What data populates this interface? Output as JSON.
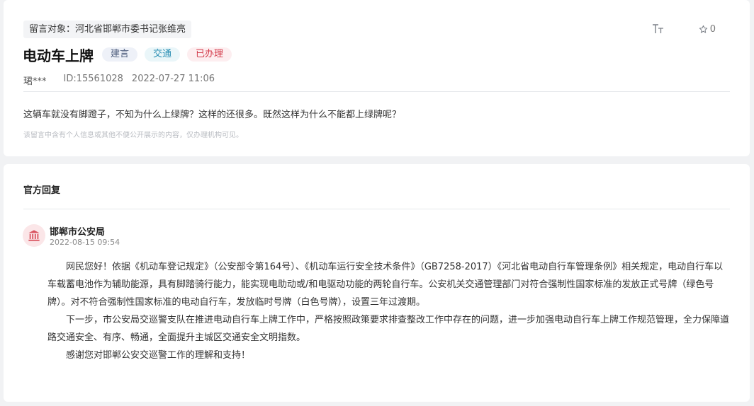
{
  "message": {
    "target": "留言对象：河北省邯郸市委书记张维亮",
    "title": "电动车上牌",
    "tags": [
      "建言",
      "交通",
      "已办理"
    ],
    "font_size_icon": "font-size-icon",
    "favorite_icon": "star-outline-icon",
    "favorite_count": "0",
    "author": "珺***",
    "id": "ID:15561028",
    "time": "2022-07-27 11:06",
    "content": "这辆车就没有脚蹬子，不知为什么上绿牌？这样的还很多。既然这样为什么不能都上绿牌呢？",
    "notice": "该留言中含有个人信息或其他不便公开展示的内容，仅办理机构可见。"
  },
  "reply": {
    "heading": "官方回复",
    "org_icon": "government-building-icon",
    "org_name": "邯郸市公安局",
    "org_time": "2022-08-15 09:54",
    "paragraphs": [
      "网民您好！依据《机动车登记规定》（公安部令第164号）、《机动车运行安全技术条件》（GB7258-2017）《河北省电动自行车管理条例》相关规定，电动自行车以车载蓄电池作为辅助能源，具有脚踏骑行能力，能实现电助动或/和电驱动功能的两轮自行车。公安机关交通管理部门对符合强制性国家标准的发放正式号牌（绿色号牌）。对不符合强制性国家标准的电动自行车，发放临时号牌（白色号牌），设置三年过渡期。",
      "下一步，市公安局交巡警支队在推进电动自行车上牌工作中，严格按照政策要求排查整改工作中存在的问题，进一步加强电动自行车上牌工作规范管理，全力保障道路交通安全、有序、畅通，全面提升主城区交通安全文明指数。",
      "感谢您对邯郸公安交巡警工作的理解和支持！"
    ]
  },
  "colors": {
    "page_bg": "#f1f2f4",
    "tag_suggest": "#4a5a7a",
    "tag_traffic": "#2b8fb4",
    "tag_done": "#d33a4a",
    "avatar_bg": "#fbe6e8",
    "avatar_icon": "#d9535f"
  }
}
